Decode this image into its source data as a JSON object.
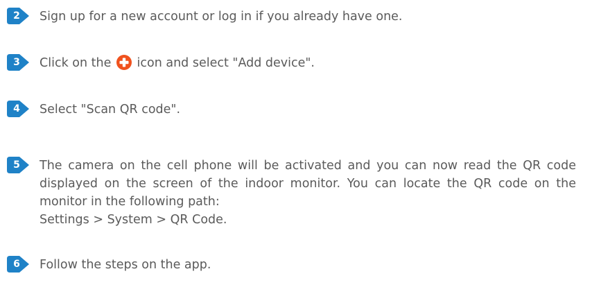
{
  "colors": {
    "badge": "#1f82c7",
    "text": "#5a5a5a",
    "plus_icon": "#f0521e"
  },
  "steps": [
    {
      "number": "2",
      "text": "Sign up for a new account or log in if you already have one."
    },
    {
      "number": "3",
      "text_before": "Click on the",
      "icon": "plus-circle-icon",
      "text_after": "icon and select \"Add device\"."
    },
    {
      "number": "4",
      "text": "Select \"Scan QR code\"."
    },
    {
      "number": "5",
      "text": "The camera on the cell phone will be activated and you can now read the QR code displayed on the screen of the indoor monitor. You can locate the QR code on the monitor in the following path:",
      "path": "Settings > System > QR Code."
    },
    {
      "number": "6",
      "text": "Follow the steps on the app."
    }
  ]
}
